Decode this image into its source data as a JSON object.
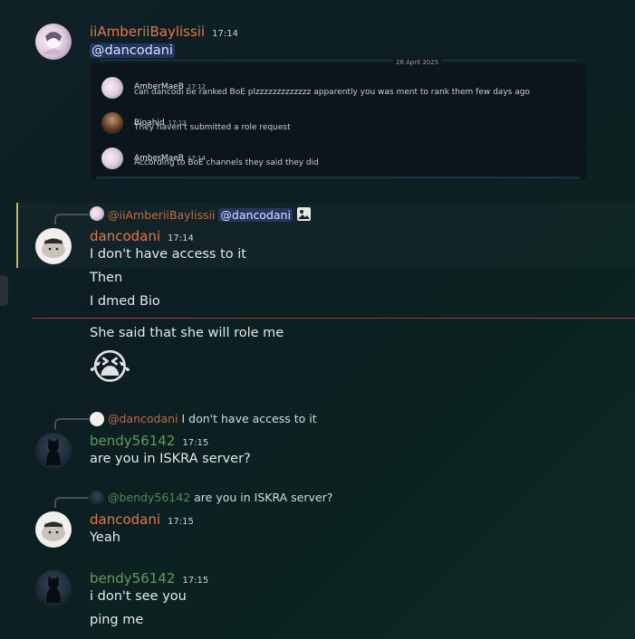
{
  "colors": {
    "orange_name": "#e8763f",
    "green_name": "#5d9e5c",
    "mention_bg": "#5865f2",
    "divider": "#a23a3d"
  },
  "msg1": {
    "author": "iiAmberiiBaylissii",
    "time": "17:14",
    "mention": "@dancodani",
    "embed": {
      "date": "26 April 2025",
      "items": [
        {
          "author": "AmberMaeB",
          "time": "17:12",
          "text": "can dancodi be ranked BoE plzzzzzzzzzzzzz apparently you was ment to rank them few days ago"
        },
        {
          "author": "Bioahid",
          "time": "17:13",
          "text": "They haven't submitted a role request"
        },
        {
          "author": "AmberMaeB",
          "time": "17:14",
          "text": "According to BoE channels they said they did"
        }
      ]
    }
  },
  "msg2": {
    "reply_author": "@iiAmberiiBaylissii",
    "reply_mention": "@dancodani",
    "reply_icon": "image-icon",
    "author": "dancodani",
    "time": "17:14",
    "lines": [
      "I don't have access to it",
      "Then",
      "I dmed Bio"
    ],
    "after_divider": "She said that she will role me",
    "emoji": "😭"
  },
  "msg3": {
    "reply_author": "@dancodani",
    "reply_text": "I don't have access to it",
    "author": "bendy56142",
    "time": "17:15",
    "text": "are you in ISKRA server?"
  },
  "msg4": {
    "reply_author": "@bendy56142",
    "reply_text": "are you in ISKRA server?",
    "author": "dancodani",
    "time": "17:15",
    "text": "Yeah"
  },
  "msg5": {
    "author": "bendy56142",
    "time": "17:15",
    "lines": [
      "i don't see you",
      "ping me"
    ]
  }
}
